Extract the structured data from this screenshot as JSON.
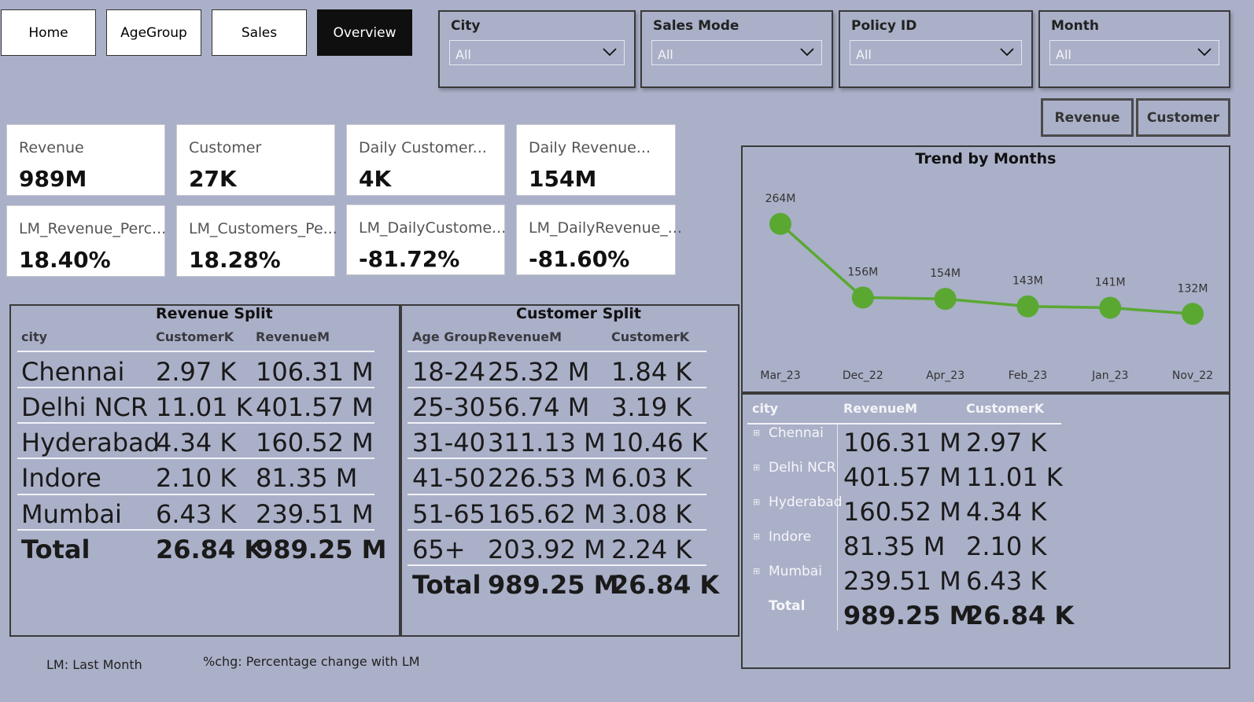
{
  "nav": {
    "home": "Home",
    "agegroup": "AgeGroup",
    "sales": "Sales",
    "overview": "Overview"
  },
  "slicers": [
    {
      "title": "City",
      "value": "All"
    },
    {
      "title": "Sales Mode",
      "value": "All"
    },
    {
      "title": "Policy ID",
      "value": "All"
    },
    {
      "title": "Month",
      "value": "All"
    }
  ],
  "toggles": {
    "revenue": "Revenue",
    "customer": "Customer"
  },
  "cards": [
    {
      "label": "Revenue",
      "value": "989M"
    },
    {
      "label": "Customer",
      "value": "27K"
    },
    {
      "label": "Daily Customer...",
      "value": "4K"
    },
    {
      "label": "Daily Revenue...",
      "value": "154M"
    },
    {
      "label": "LM_Revenue_Perc...",
      "value": "18.40%"
    },
    {
      "label": "LM_Customers_Pe...",
      "value": "18.28%"
    },
    {
      "label": "LM_DailyCustome...",
      "value": "-81.72%"
    },
    {
      "label": "LM_DailyRevenue_...",
      "value": "-81.60%"
    }
  ],
  "revenue_split": {
    "title": "Revenue Split",
    "headers": [
      "city",
      "CustomerK",
      "RevenueM"
    ],
    "rows": [
      [
        "Chennai",
        "2.97 K",
        "106.31 M"
      ],
      [
        "Delhi NCR",
        "11.01 K",
        "401.57 M"
      ],
      [
        "Hyderabad",
        "4.34 K",
        "160.52 M"
      ],
      [
        "Indore",
        "2.10 K",
        "81.35 M"
      ],
      [
        "Mumbai",
        "6.43 K",
        "239.51 M"
      ]
    ],
    "total": [
      "Total",
      "26.84 K",
      "989.25 M"
    ]
  },
  "customer_split": {
    "title": "Customer Split",
    "headers": [
      "Age Group",
      "RevenueM",
      "CustomerK"
    ],
    "rows": [
      [
        "18-24",
        "25.32 M",
        "1.84 K"
      ],
      [
        "25-30",
        "56.74 M",
        "3.19 K"
      ],
      [
        "31-40",
        "311.13 M",
        "10.46 K"
      ],
      [
        "41-50",
        "226.53 M",
        "6.03 K"
      ],
      [
        "51-65",
        "165.62 M",
        "3.08 K"
      ],
      [
        "65+",
        "203.92 M",
        "2.24 K"
      ]
    ],
    "total": [
      "Total",
      "989.25 M",
      "26.84 K"
    ]
  },
  "chart_data": {
    "type": "line",
    "title": "Trend by Months",
    "categories": [
      "Mar_23",
      "Dec_22",
      "Apr_23",
      "Feb_23",
      "Jan_23",
      "Nov_22"
    ],
    "values": [
      264,
      156,
      154,
      143,
      141,
      132
    ],
    "labels": [
      "264M",
      "156M",
      "154M",
      "143M",
      "141M",
      "132M"
    ],
    "color": "#5aa832",
    "grid": false,
    "ylim": [
      100,
      280
    ]
  },
  "city_table": {
    "headers": [
      "city",
      "RevenueM",
      "CustomerK"
    ],
    "expand_icon": "⊞",
    "rows": [
      [
        "Chennai",
        "106.31 M",
        "2.97 K"
      ],
      [
        "Delhi NCR",
        "401.57 M",
        "11.01 K"
      ],
      [
        "Hyderabad",
        "160.52 M",
        "4.34 K"
      ],
      [
        "Indore",
        "81.35 M",
        "2.10 K"
      ],
      [
        "Mumbai",
        "239.51 M",
        "6.43 K"
      ]
    ],
    "total": [
      "Total",
      "989.25 M",
      "26.84 K"
    ]
  },
  "notes": {
    "lm": "LM: Last Month",
    "chg": "%chg: Percentage change with LM"
  }
}
